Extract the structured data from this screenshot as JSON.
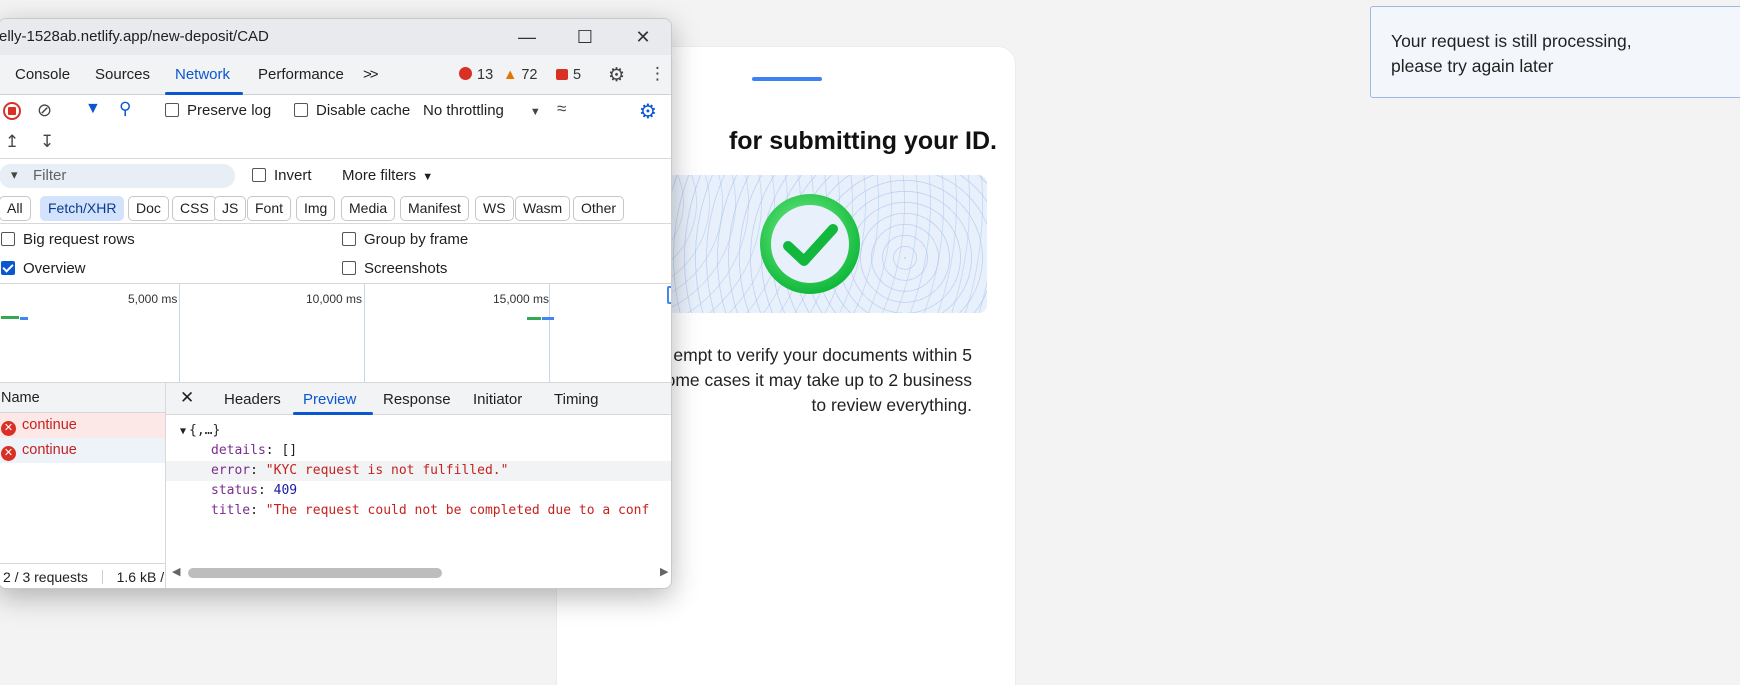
{
  "page": {
    "title_fragment": "for submitting your ID.",
    "body_text_lines": [
      "empt to verify your documents within 5",
      "some cases it may take up to 2 business",
      "to review everything."
    ]
  },
  "toast": {
    "line1": "Your request is still processing,",
    "line2": "please try again later"
  },
  "devtools": {
    "url": "elly-1528ab.netlify.app/new-deposit/CAD",
    "tabs": [
      "Console",
      "Sources",
      "Network",
      "Performance"
    ],
    "active_tab": "Network",
    "more_tabs": ">>",
    "errors": "13",
    "warnings": "72",
    "issues": "5",
    "toolbar": {
      "preserve_log": "Preserve log",
      "disable_cache": "Disable cache",
      "throttling": "No throttling"
    },
    "filter": {
      "placeholder": "Filter",
      "invert": "Invert",
      "more_filters": "More filters"
    },
    "type_chips": [
      "All",
      "Fetch/XHR",
      "Doc",
      "CSS",
      "JS",
      "Font",
      "Img",
      "Media",
      "Manifest",
      "WS",
      "Wasm",
      "Other"
    ],
    "active_chip": "Fetch/XHR",
    "options": {
      "big_request_rows": "Big request rows",
      "group_by_frame": "Group by frame",
      "overview": "Overview",
      "screenshots": "Screenshots",
      "overview_checked": true
    },
    "timeline_labels": [
      "5,000 ms",
      "10,000 ms",
      "15,000 ms"
    ],
    "name_header": "Name",
    "requests": [
      "continue",
      "continue"
    ],
    "status": {
      "requests": "2 / 3 requests",
      "size": "1.6 kB /"
    },
    "detail_tabs": [
      "Headers",
      "Preview",
      "Response",
      "Initiator",
      "Timing"
    ],
    "active_detail_tab": "Preview",
    "preview": {
      "root": "{,…}",
      "lines": [
        {
          "key": "details",
          "value": "[]",
          "kind": "plain"
        },
        {
          "key": "error",
          "value": "\"KYC request is not fulfilled.\"",
          "kind": "str"
        },
        {
          "key": "status",
          "value": "409",
          "kind": "num"
        },
        {
          "key": "title",
          "value": "\"The request could not be completed due to a conf",
          "kind": "str"
        }
      ]
    }
  }
}
